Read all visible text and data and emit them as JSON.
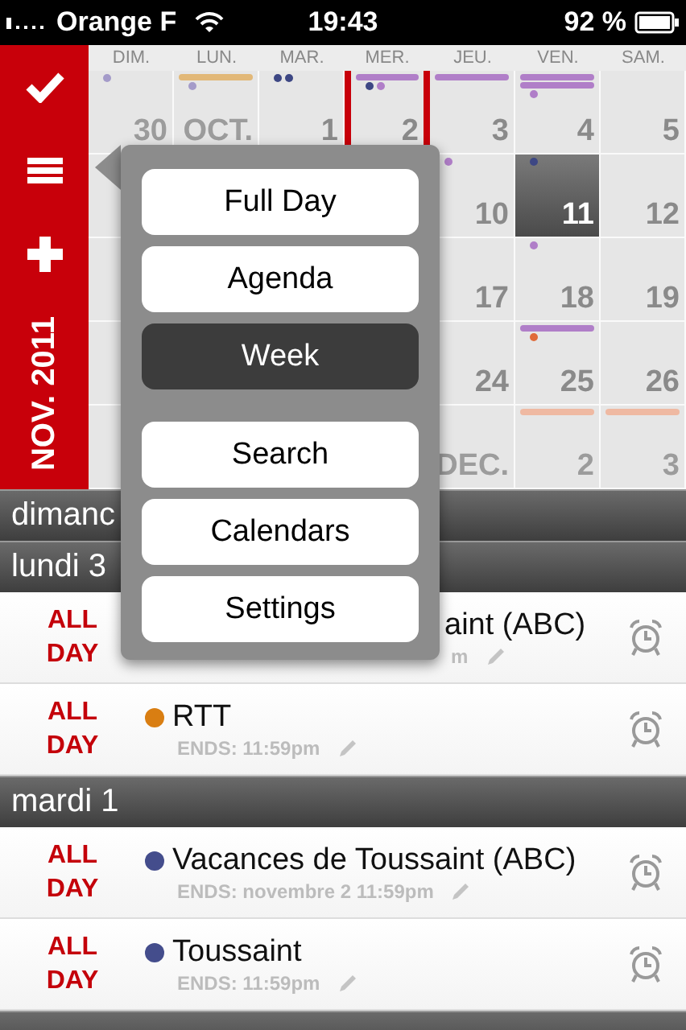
{
  "status_bar": {
    "carrier": "Orange F",
    "time": "19:43",
    "battery": "92 %"
  },
  "sidebar": {
    "month": "NOV. 2011"
  },
  "calendar": {
    "weekdays": [
      "DIM.",
      "LUN.",
      "MAR.",
      "MER.",
      "JEU.",
      "VEN.",
      "SAM."
    ],
    "weeks": [
      {
        "days": [
          {
            "label": "30",
            "muted": true,
            "selected": false,
            "today": false,
            "marks": [
              {
                "kind": "dot",
                "color": "#a49bc9"
              }
            ]
          },
          {
            "label": "OCT.",
            "muted": true,
            "selected": false,
            "today": false,
            "marks": [
              {
                "kind": "bar",
                "color": "#e2b878"
              },
              {
                "kind": "dot",
                "color": "#a49bc9"
              }
            ]
          },
          {
            "label": "1",
            "muted": false,
            "selected": false,
            "today": false,
            "marks": [
              {
                "kind": "dot",
                "color": "#3d4784"
              },
              {
                "kind": "dot",
                "color": "#3d4784"
              }
            ]
          },
          {
            "label": "2",
            "muted": false,
            "selected": false,
            "today": true,
            "marks": [
              {
                "kind": "bar",
                "color": "#b07ec8"
              },
              {
                "kind": "dot",
                "color": "#3d4784"
              },
              {
                "kind": "dot",
                "color": "#b07ec8"
              }
            ]
          },
          {
            "label": "3",
            "muted": false,
            "selected": false,
            "today": false,
            "marks": [
              {
                "kind": "bar",
                "color": "#b07ec8"
              }
            ]
          },
          {
            "label": "4",
            "muted": false,
            "selected": false,
            "today": false,
            "marks": [
              {
                "kind": "bar",
                "color": "#b07ec8"
              },
              {
                "kind": "bar",
                "color": "#b07ec8"
              },
              {
                "kind": "dot",
                "color": "#b07ec8"
              }
            ]
          },
          {
            "label": "5",
            "muted": false,
            "selected": false,
            "today": false
          }
        ]
      },
      {
        "days": [
          {
            "label": "10",
            "muted": false,
            "selected": false,
            "today": false,
            "marks": [
              {
                "kind": "dot",
                "color": "#b07ec8"
              }
            ]
          },
          {
            "label": "11",
            "muted": false,
            "selected": true,
            "today": false,
            "marks": [
              {
                "kind": "dot",
                "color": "#3d4784"
              }
            ]
          },
          {
            "label": "12",
            "muted": false,
            "selected": false,
            "today": false
          }
        ]
      },
      {
        "days": [
          {
            "label": "17",
            "muted": false,
            "selected": false,
            "today": false
          },
          {
            "label": "18",
            "muted": false,
            "selected": false,
            "today": false,
            "marks": [
              {
                "kind": "dot",
                "color": "#b07ec8"
              }
            ]
          },
          {
            "label": "19",
            "muted": false,
            "selected": false,
            "today": false
          }
        ]
      },
      {
        "days": [
          {
            "label": "24",
            "muted": false,
            "selected": false,
            "today": false
          },
          {
            "label": "25",
            "muted": false,
            "selected": false,
            "today": false,
            "marks": [
              {
                "kind": "bar",
                "color": "#b07ec8"
              },
              {
                "kind": "dot",
                "color": "#e06a3a"
              }
            ]
          },
          {
            "label": "26",
            "muted": false,
            "selected": false,
            "today": false
          }
        ]
      },
      {
        "days": [
          {
            "label": "DEC.",
            "muted": true,
            "selected": false,
            "today": false
          },
          {
            "label": "2",
            "muted": true,
            "selected": false,
            "today": false,
            "marks": [
              {
                "kind": "bar",
                "color": "#efb9a2"
              }
            ]
          },
          {
            "label": "3",
            "muted": true,
            "selected": false,
            "today": false,
            "marks": [
              {
                "kind": "bar",
                "color": "#efb9a2"
              }
            ]
          }
        ]
      }
    ]
  },
  "agenda": [
    {
      "title": "dimanc"
    },
    {
      "title": "lundi 3",
      "events": [
        {
          "time": "ALL DAY",
          "title": "aint (ABC)",
          "ends": "m",
          "covered": true
        },
        {
          "time": "ALL DAY",
          "title": "RTT",
          "ends": "ENDS: 11:59pm",
          "color": "#d97e12",
          "covered": false
        }
      ]
    },
    {
      "title": "mardi 1",
      "events": [
        {
          "time": "ALL DAY",
          "title": "Vacances de Toussaint (ABC)",
          "ends": "ENDS: novembre 2 11:59pm",
          "color": "#444d8c",
          "covered": false
        },
        {
          "time": "ALL DAY",
          "title": "Toussaint",
          "ends": "ENDS: 11:59pm",
          "color": "#444d8c",
          "covered": false
        }
      ]
    }
  ],
  "menu": {
    "groups": [
      [
        {
          "label": "Full Day",
          "selected": false
        },
        {
          "label": "Agenda",
          "selected": false
        },
        {
          "label": "Week",
          "selected": true
        }
      ],
      [
        {
          "label": "Search",
          "selected": false
        },
        {
          "label": "Calendars",
          "selected": false
        },
        {
          "label": "Settings",
          "selected": false
        }
      ]
    ]
  }
}
